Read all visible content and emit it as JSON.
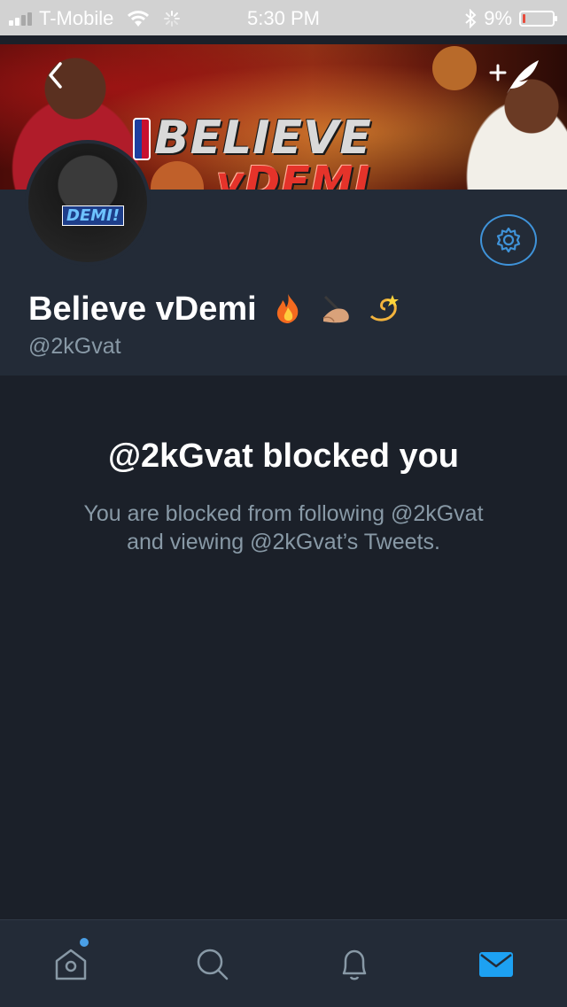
{
  "status_bar": {
    "carrier": "T-Mobile",
    "time": "5:30 PM",
    "battery_percent": "9%",
    "battery_level": 0.09,
    "signal_bars_filled": 2,
    "signal_bars_total": 4
  },
  "banner": {
    "brand_line1": "BELIEVE",
    "brand_line2": "vDEMI",
    "back_icon": "chevron-left-icon",
    "compose_icon": "compose-tweet-icon"
  },
  "profile": {
    "name": "Believe vDemi",
    "name_emojis": [
      "fire-emoji",
      "writing-hand-emoji",
      "dizzy-emoji"
    ],
    "handle": "@2kGvat",
    "avatar_text": "DEMI!",
    "settings_icon": "gear-icon"
  },
  "blocked": {
    "title": "@2kGvat blocked you",
    "description": "You are blocked from following @2kGvat and viewing @2kGvat’s Tweets."
  },
  "tab_bar": {
    "tabs": [
      {
        "id": "home",
        "icon": "home-icon",
        "active": false,
        "has_notification_dot": true
      },
      {
        "id": "search",
        "icon": "search-icon",
        "active": false
      },
      {
        "id": "notifications",
        "icon": "bell-icon",
        "active": false
      },
      {
        "id": "messages",
        "icon": "envelope-icon",
        "active": true
      }
    ]
  },
  "colors": {
    "background": "#1b2029",
    "header_bg": "#232b37",
    "accent": "#1da1f2",
    "muted_text": "#8899a6"
  }
}
